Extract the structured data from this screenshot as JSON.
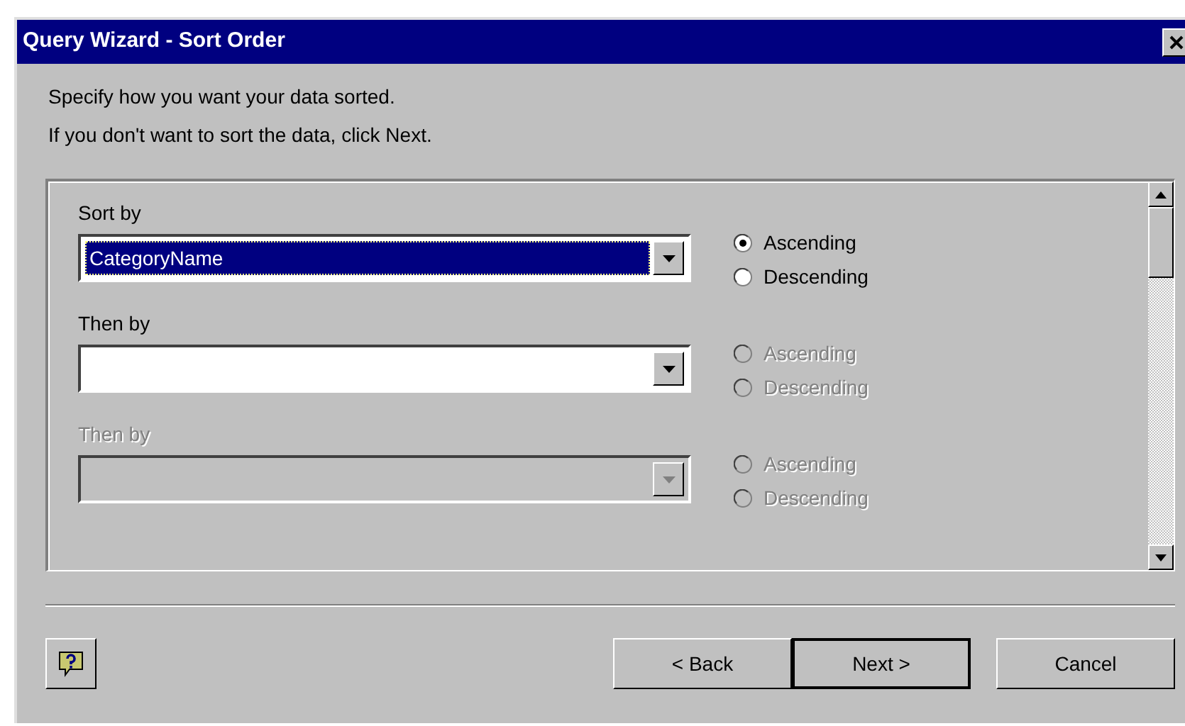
{
  "window": {
    "title": "Query Wizard - Sort Order"
  },
  "instructions": [
    "Specify how you want your data sorted.",
    "If you don't want to sort the data, click Next."
  ],
  "sort_levels": [
    {
      "label": "Sort by",
      "value": "CategoryName",
      "highlighted": true,
      "disabled": false,
      "options": [
        {
          "label": "Ascending",
          "selected": true,
          "disabled": false
        },
        {
          "label": "Descending",
          "selected": false,
          "disabled": false
        }
      ]
    },
    {
      "label": "Then by",
      "disabled": false,
      "options": [
        {
          "label": "Ascending",
          "selected": false,
          "disabled": true
        },
        {
          "label": "Descending",
          "selected": false,
          "disabled": true
        }
      ]
    },
    {
      "label": "Then by",
      "disabled": true,
      "options": [
        {
          "label": "Ascending",
          "selected": false,
          "disabled": true
        },
        {
          "label": "Descending",
          "selected": false,
          "disabled": true
        }
      ]
    }
  ],
  "buttons": [
    {
      "kind": "help"
    },
    {
      "kind": "text",
      "label": "< Back",
      "default": false
    },
    {
      "kind": "text",
      "label": "Next >",
      "default": true
    },
    {
      "kind": "text",
      "label": "Cancel",
      "default": false
    }
  ]
}
